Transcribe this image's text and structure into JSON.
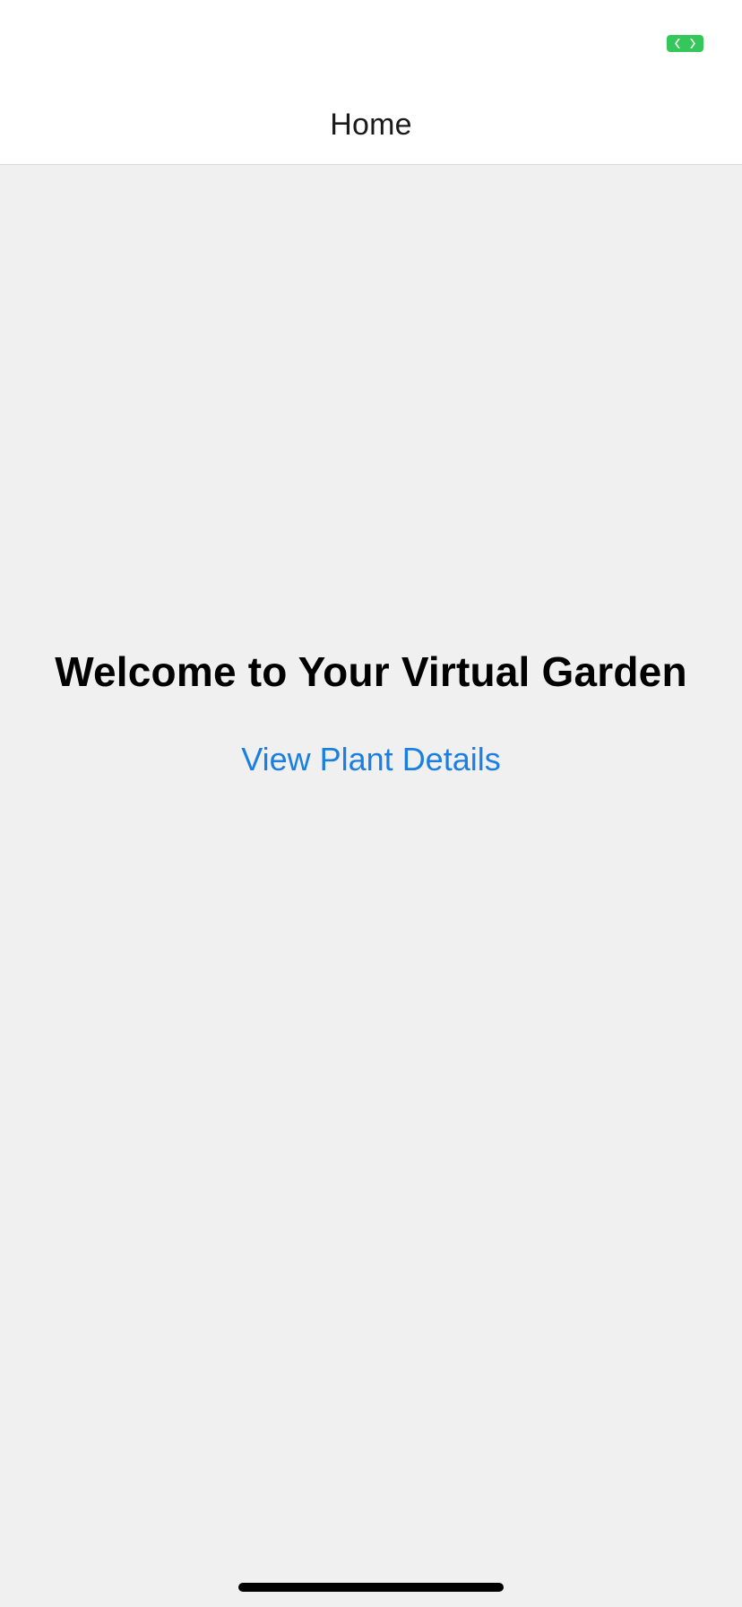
{
  "status_bar": {
    "indicator_icon": "camera-in-use-indicator",
    "indicator_color": "#34c759"
  },
  "nav": {
    "title": "Home"
  },
  "main": {
    "welcome_text": "Welcome to Your Virtual Garden",
    "details_link_label": "View Plant Details",
    "link_color": "#1a7fe0"
  }
}
